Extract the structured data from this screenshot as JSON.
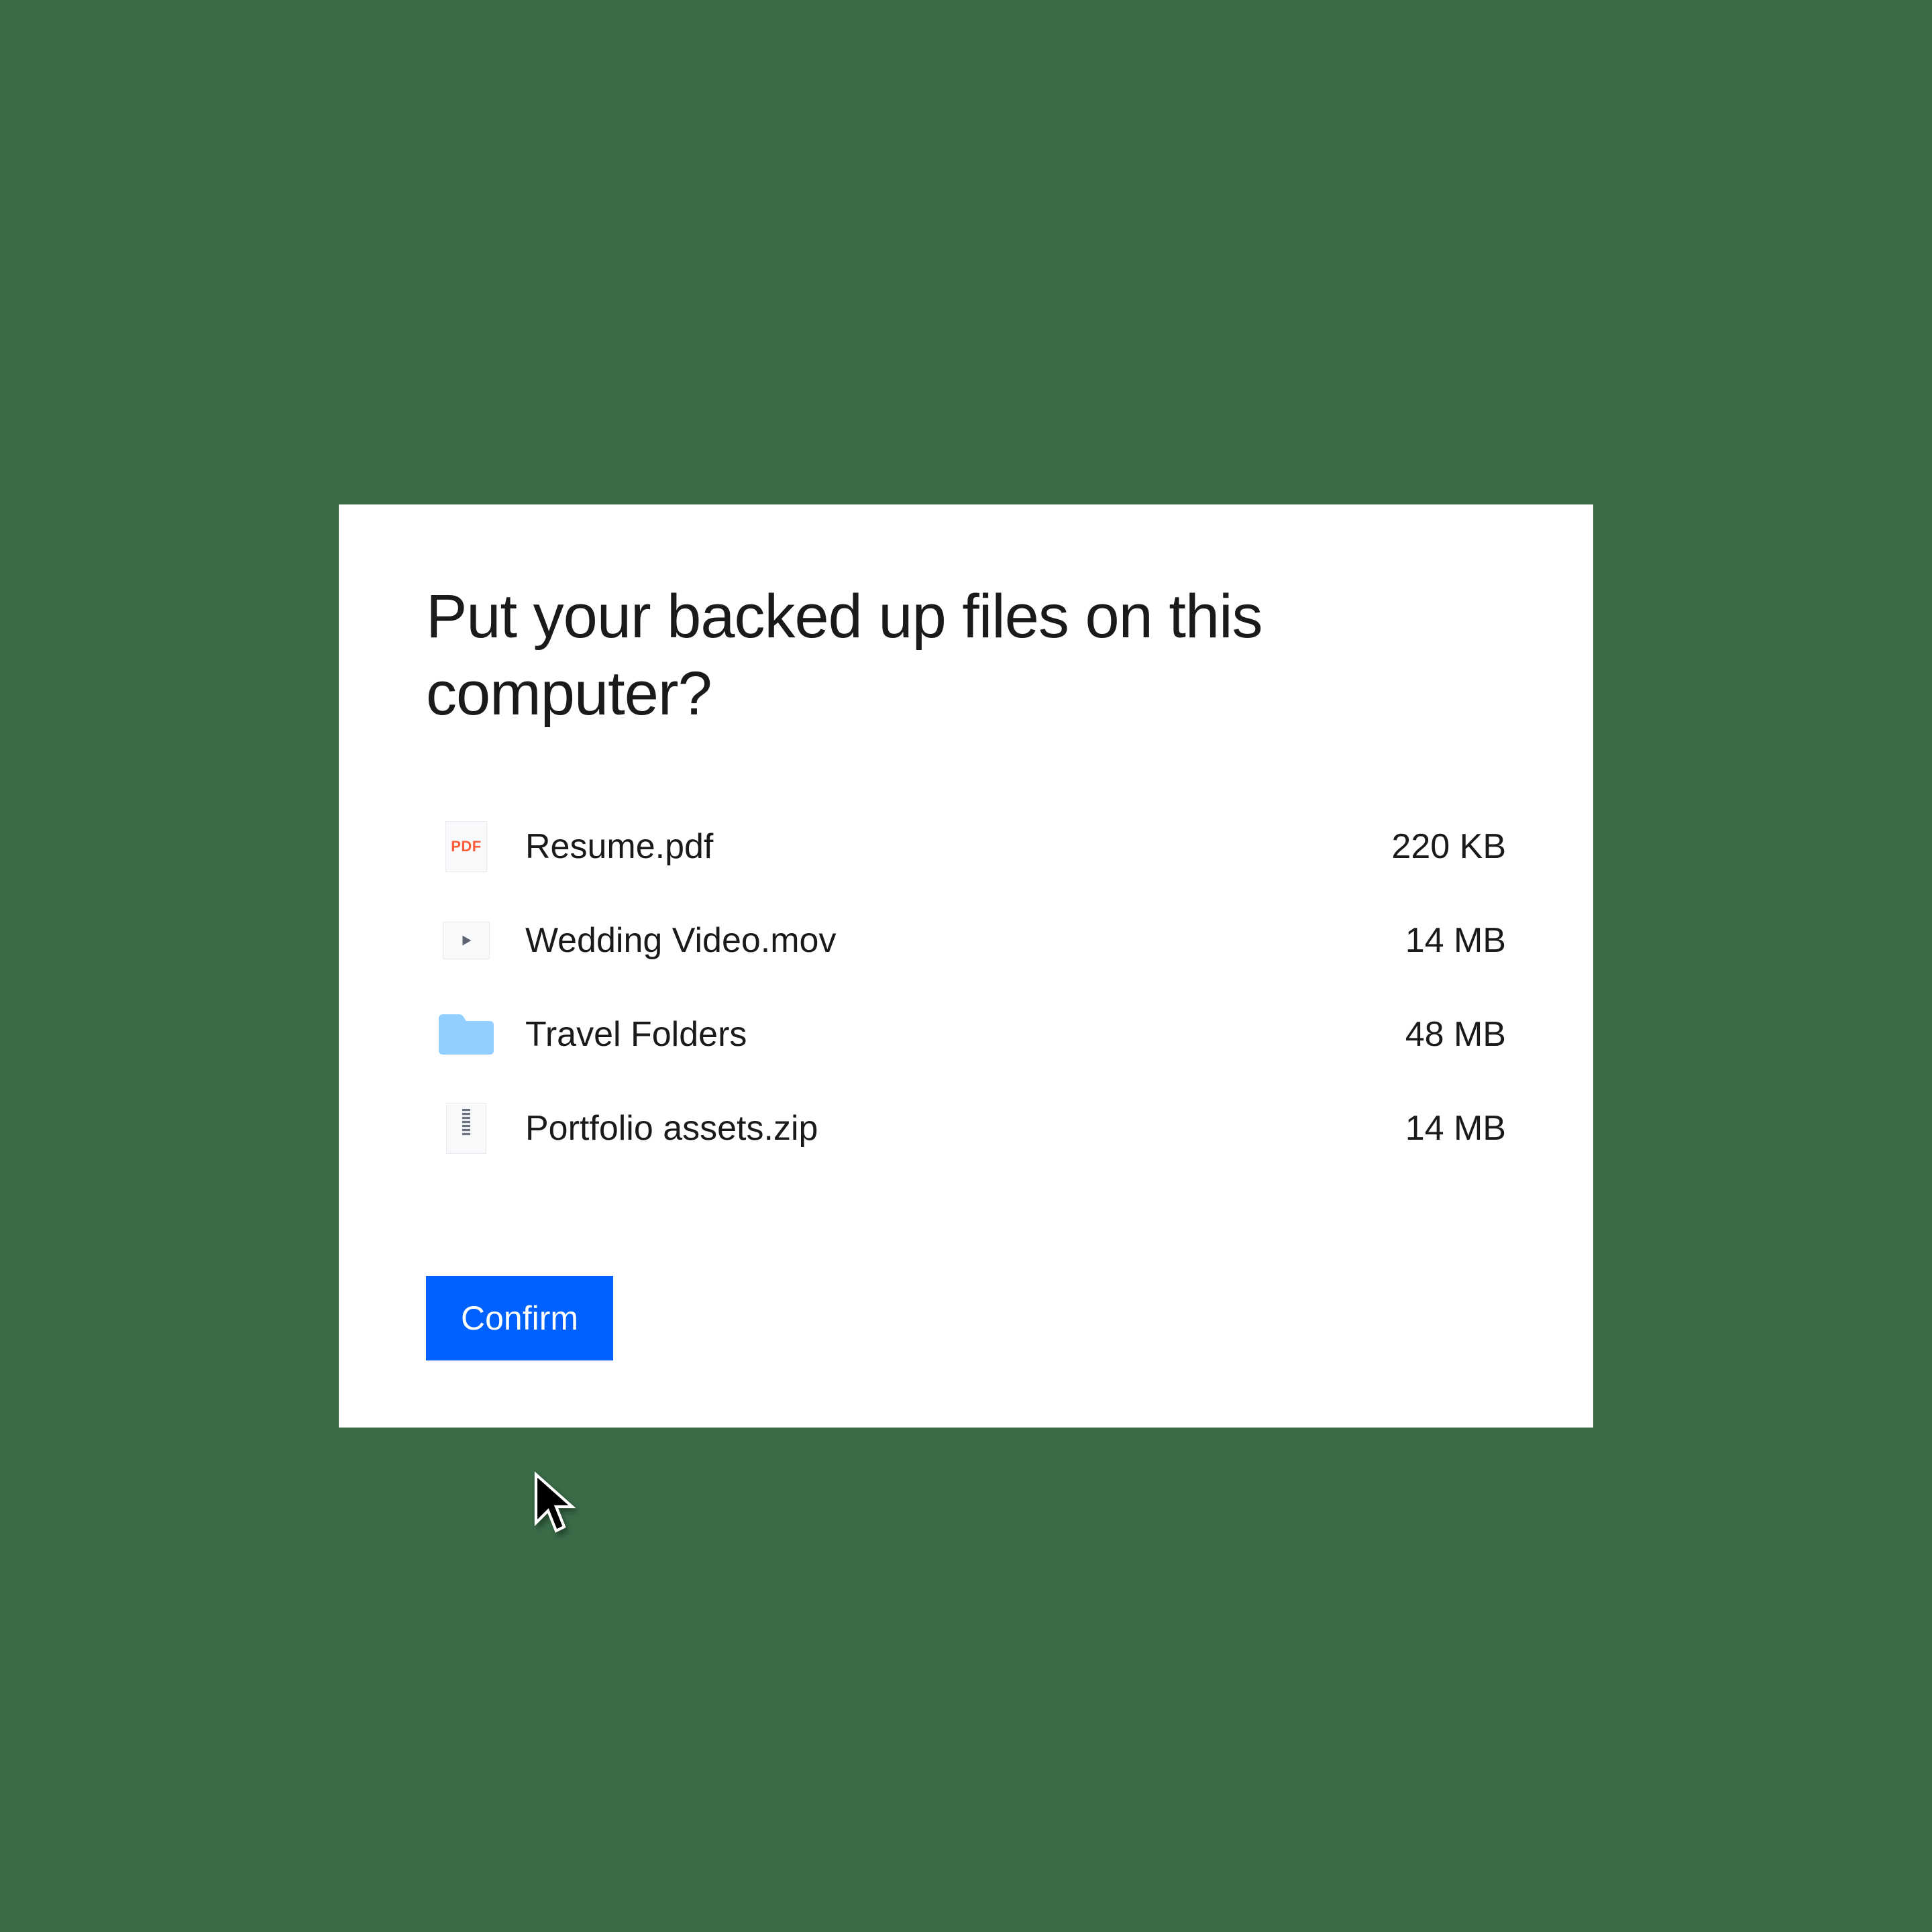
{
  "dialog": {
    "title": "Put your backed up files on this computer?",
    "confirm_label": "Confirm"
  },
  "files": [
    {
      "icon": "pdf",
      "name": "Resume.pdf",
      "size": "220 KB"
    },
    {
      "icon": "video",
      "name": "Wedding Video.mov",
      "size": "14 MB"
    },
    {
      "icon": "folder",
      "name": "Travel Folders",
      "size": "48 MB"
    },
    {
      "icon": "zip",
      "name": "Portfolio assets.zip",
      "size": "14 MB"
    }
  ],
  "icon_labels": {
    "pdf": "PDF"
  },
  "colors": {
    "background": "#3a6b47",
    "accent": "#0061fe",
    "folder": "#92ceff",
    "pdf_text": "#ff5b3a"
  }
}
